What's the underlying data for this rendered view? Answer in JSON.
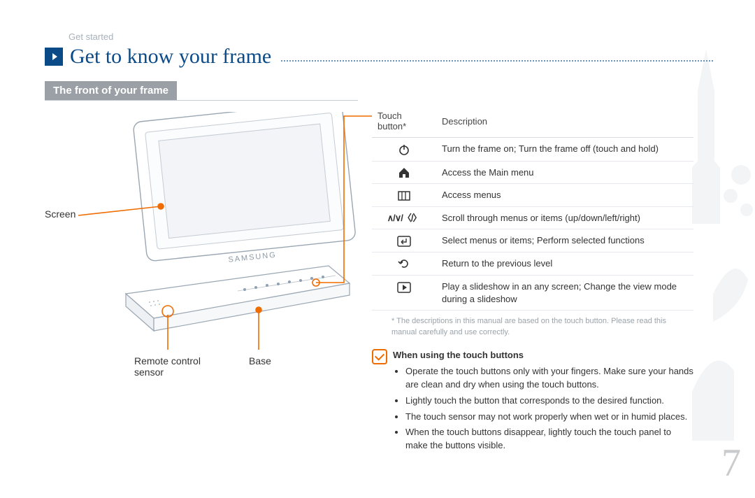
{
  "breadcrumb": "Get started",
  "title": "Get to know your frame",
  "section_heading": "The front of your frame",
  "page_number": "7",
  "diagram": {
    "brand": "SAMSUNG",
    "labels": {
      "screen": "Screen",
      "remote_sensor": "Remote control\nsensor",
      "base": "Base"
    }
  },
  "table": {
    "header": {
      "col1": "Touch button*",
      "col2": "Description"
    },
    "rows": [
      {
        "icon": "power-icon",
        "desc": "Turn the frame on; Turn the frame off (touch and hold)"
      },
      {
        "icon": "home-icon",
        "desc": "Access the Main menu"
      },
      {
        "icon": "menu-icon",
        "desc": "Access menus"
      },
      {
        "icon": "arrows-icon",
        "desc": "Scroll through menus or items (up/down/left/right)"
      },
      {
        "icon": "enter-icon",
        "desc": "Select menus or items; Perform selected functions"
      },
      {
        "icon": "back-icon",
        "desc": "Return to the previous level"
      },
      {
        "icon": "play-icon",
        "desc": "Play a slideshow in an any screen; Change the view mode during a slideshow"
      }
    ],
    "footnote": "* The descriptions in this manual are based on the touch button. Please read this manual carefully and use correctly."
  },
  "tips": {
    "heading": "When using the touch buttons",
    "items": [
      "Operate the touch buttons only with your fingers. Make sure your hands are clean and dry when using the touch buttons.",
      "Lightly touch the button that corresponds to the desired function.",
      "The touch sensor may not work properly when wet or in humid places.",
      "When the touch buttons disappear, lightly touch the touch panel to make the buttons visible."
    ]
  },
  "arrows_glyph": "∧/∨/〈/〉"
}
